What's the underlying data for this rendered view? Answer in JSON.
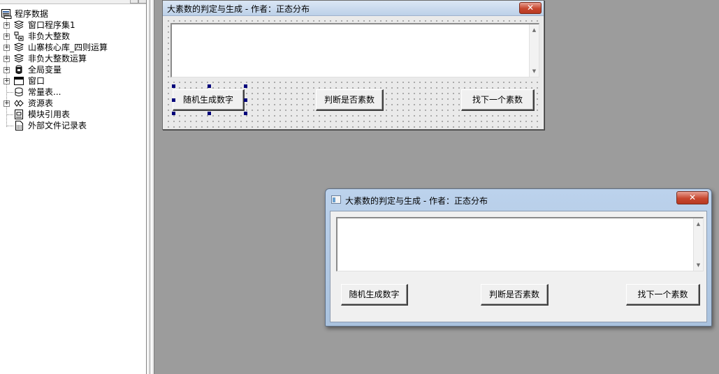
{
  "tree": {
    "root_label": "程序数据",
    "items": [
      {
        "label": "窗口程序集1",
        "icon": "module-stack-icon",
        "expandable": true
      },
      {
        "label": "非负大整数",
        "icon": "data-type-icon",
        "expandable": true
      },
      {
        "label": "山寨核心库_四则运算",
        "icon": "module-stack-icon",
        "expandable": true
      },
      {
        "label": "非负大整数运算",
        "icon": "module-stack-icon",
        "expandable": true
      },
      {
        "label": "全局变量",
        "icon": "global-variable-icon",
        "expandable": true
      },
      {
        "label": "窗口",
        "icon": "window-icon",
        "expandable": true
      },
      {
        "label": "常量表...",
        "icon": "constant-table-icon",
        "expandable": false
      },
      {
        "label": "资源表",
        "icon": "resource-table-icon",
        "expandable": true
      },
      {
        "label": "模块引用表",
        "icon": "module-reference-icon",
        "expandable": false
      },
      {
        "label": "外部文件记录表",
        "icon": "external-file-icon",
        "expandable": false
      }
    ]
  },
  "design_form": {
    "title": "大素数的判定与生成 - 作者：正态分布",
    "close_label": "✕",
    "buttons": {
      "random": "随机生成数字",
      "check": "判断是否素数",
      "next": "找下一个素数"
    },
    "selected_control": "随机生成数字"
  },
  "runtime_form": {
    "title": "大素数的判定与生成 - 作者：正态分布",
    "close_label": "✕",
    "buttons": {
      "random": "随机生成数字",
      "check": "判断是否素数",
      "next": "找下一个素数"
    }
  },
  "scroll": {
    "up_arrow": "▲",
    "down_arrow": "▼"
  },
  "expander_symbol": "+"
}
